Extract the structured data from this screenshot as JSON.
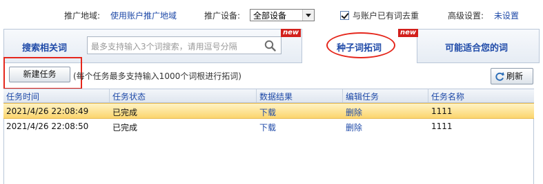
{
  "settings": {
    "region_label": "推广地域:",
    "region_value": "使用账户推广地域",
    "device_label": "推广设备:",
    "device_selected": "全部设备",
    "dedupe_label": "与账户已有词去重",
    "dedupe_checked": true,
    "advanced_label": "高级设置:",
    "advanced_value": "未设置"
  },
  "tabs": [
    {
      "label": "搜索相关词",
      "badge": ""
    },
    {
      "label": "种子词拓词",
      "badge": "new",
      "active": true
    },
    {
      "label": "可能适合您的词",
      "badge": ""
    }
  ],
  "search": {
    "placeholder": "最多支持输入3个词搜索，请用逗号分隔",
    "badge": "new"
  },
  "toolbar": {
    "new_task_label": "新建任务",
    "hint": "(每个任务最多支持输入1000个词根进行拓词)",
    "refresh_label": "刷新"
  },
  "table": {
    "columns": [
      "任务时间",
      "任务状态",
      "数据结果",
      "编辑任务",
      "任务名称"
    ],
    "rows": [
      {
        "time": "2021/4/26 22:08:49",
        "status": "已完成",
        "result": "下载",
        "edit": "删除",
        "name": "1111"
      },
      {
        "time": "2021/4/26 22:08:50",
        "status": "已完成",
        "result": "下载",
        "edit": "删除",
        "name": "1111"
      }
    ]
  },
  "colors": {
    "link": "#1f4aa8",
    "highlight": "#e5261b",
    "selected_row": "#fbd56e",
    "badge": "#d2201c"
  }
}
